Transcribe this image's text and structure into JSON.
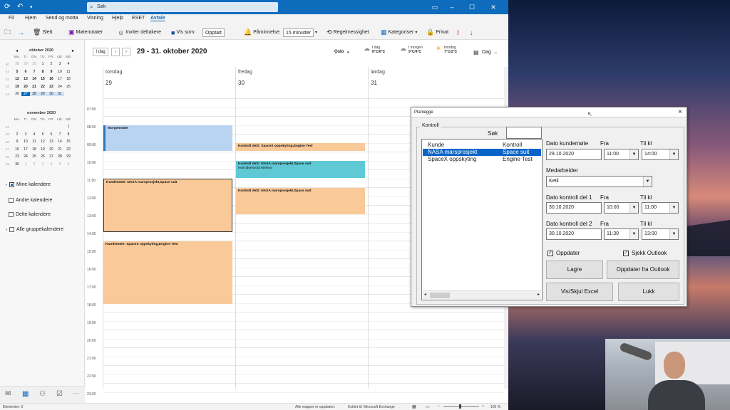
{
  "window": {
    "search_placeholder": "Søk"
  },
  "menu": [
    "Fil",
    "Hjem",
    "Send og motta",
    "Visning",
    "Hjelp",
    "ESET",
    "Avtale"
  ],
  "ribbon": {
    "delete": "Slett",
    "meeting_notes": "Møtenotater",
    "invite": "Inviter deltakere",
    "show_as_label": "Vis som:",
    "show_as_value": "Opptatt",
    "reminder_label": "Påminnelse:",
    "reminder_value": "15 minutter",
    "recurrence": "Regelmessighet",
    "categorize": "Kategoriser",
    "private": "Privat"
  },
  "minical_oct": {
    "title": "oktober 2020",
    "days": [
      "MA.",
      "TI.",
      "ON.",
      "TO.",
      "FR.",
      "LØ.",
      "SØ."
    ],
    "weeks": [
      {
        "wk": "40",
        "d": [
          "28",
          "29",
          "30",
          "1",
          "2",
          "3",
          "4"
        ]
      },
      {
        "wk": "41",
        "d": [
          "5",
          "6",
          "7",
          "8",
          "9",
          "10",
          "11"
        ]
      },
      {
        "wk": "42",
        "d": [
          "12",
          "13",
          "14",
          "15",
          "16",
          "17",
          "18"
        ]
      },
      {
        "wk": "43",
        "d": [
          "19",
          "20",
          "21",
          "22",
          "23",
          "24",
          "25"
        ]
      },
      {
        "wk": "44",
        "d": [
          "26",
          "27",
          "28",
          "29",
          "30",
          "31",
          ""
        ]
      }
    ]
  },
  "minical_nov": {
    "title": "november 2020",
    "days": [
      "MA.",
      "TI.",
      "ON.",
      "TO.",
      "FR.",
      "LØ.",
      "SØ."
    ],
    "weeks": [
      {
        "wk": "44",
        "d": [
          "",
          "",
          "",
          "",
          "",
          "",
          "1"
        ]
      },
      {
        "wk": "45",
        "d": [
          "2",
          "3",
          "4",
          "5",
          "6",
          "7",
          "8"
        ]
      },
      {
        "wk": "46",
        "d": [
          "9",
          "10",
          "11",
          "12",
          "13",
          "14",
          "15"
        ]
      },
      {
        "wk": "47",
        "d": [
          "16",
          "17",
          "18",
          "19",
          "20",
          "21",
          "22"
        ]
      },
      {
        "wk": "48",
        "d": [
          "23",
          "24",
          "25",
          "26",
          "27",
          "28",
          "29"
        ]
      },
      {
        "wk": "49",
        "d": [
          "30",
          "1",
          "2",
          "3",
          "4",
          "5",
          "6"
        ]
      }
    ]
  },
  "calendars": {
    "mine": "Mine kalendere",
    "other": "Andre kalendere",
    "shared": "Delte kalendere",
    "all_groups": "Alle gruppekalendere"
  },
  "calhead": {
    "today": "I dag",
    "range": "29 - 31. oktober 2020",
    "location": "Oslo",
    "wx": [
      {
        "day": "I dag",
        "temp": "8°C/6°C"
      },
      {
        "day": "I morgen",
        "temp": "9°C/4°C"
      },
      {
        "day": "torsdag",
        "temp": "7°C/2°C"
      }
    ],
    "view": "Dag"
  },
  "days": [
    {
      "name": "torsdag",
      "date": "29"
    },
    {
      "name": "fredag",
      "date": "30"
    },
    {
      "name": "lørdag",
      "date": "31"
    }
  ],
  "times": [
    "07:00",
    "08:00",
    "09:00",
    "10:00",
    "11:00",
    "12:00",
    "13:00",
    "14:00",
    "15:00",
    "16:00",
    "17:00",
    "18:00",
    "19:00",
    "20:00",
    "21:00",
    "22:00",
    "23:00"
  ],
  "events": {
    "e1": "Morgenmøte",
    "e2": "Kundemøte: NASA marsprosjekt,Space suit",
    "e3": "Kundemøte: SpaceX oppskyting,Engine Test",
    "e4": "Kontroll del2: SpaceX oppskyting,Engine Test",
    "e5": "Kontroll del1: NASA marsprosjekt,Space suit",
    "e5_sub": "Ketil Øyesvold Melhus",
    "e6": "Kontroll del2: NASA marsprosjekt,Space suit"
  },
  "status": {
    "elements": "Elementer: 6",
    "folders": "Alle mapper er oppdatert.",
    "connected": "Koblet til: Microsoft Exchange",
    "zoom": "100 %"
  },
  "dialog": {
    "title": "Planlegge",
    "group": "Kontroll",
    "search_label": "Søk",
    "list_headers": [
      "Kunde",
      "Kontroll"
    ],
    "list_rows": [
      {
        "kunde": "NASA marsprosjekt",
        "kontroll": "Space suit"
      },
      {
        "kunde": "SpaceX oppskyting",
        "kontroll": "Engine Test"
      }
    ],
    "dato_kundemote": "Dato kundemøte",
    "fra": "Fra",
    "til_kl": "Til kl",
    "kundemote_date": "29.10.2020",
    "kundemote_fra": "11:00",
    "kundemote_til": "14:00",
    "medarbeider_label": "Medarbeider",
    "medarbeider": "Ketil",
    "dato_k1": "Dato kontroll del 1",
    "k1_date": "30.10.2020",
    "k1_fra": "10:00",
    "k1_til": "11:00",
    "dato_k2": "Dato kontroll del 2",
    "k2_date": "30.10.2020",
    "k2_fra": "11:30",
    "k2_til": "13:00",
    "chk_oppdater": "Oppdater",
    "chk_sjekk": "Sjekk Outlook",
    "btn_lagre": "Lagre",
    "btn_oppdater": "Oppdater fra Outlook",
    "btn_vis": "Vis/Skjul Excel",
    "btn_lukk": "Lukk"
  }
}
